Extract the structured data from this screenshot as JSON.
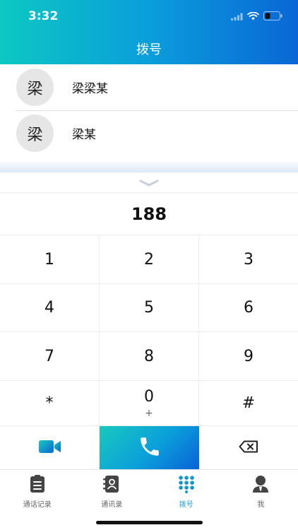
{
  "status_bar": {
    "time": "3:32"
  },
  "header": {
    "title": "拨号"
  },
  "contacts": [
    {
      "avatar": "梁",
      "name": "梁梁某"
    },
    {
      "avatar": "梁",
      "name": "梁某"
    }
  ],
  "dialer": {
    "number": "188",
    "keys": [
      {
        "main": "1",
        "sub": ""
      },
      {
        "main": "2",
        "sub": ""
      },
      {
        "main": "3",
        "sub": ""
      },
      {
        "main": "4",
        "sub": ""
      },
      {
        "main": "5",
        "sub": ""
      },
      {
        "main": "6",
        "sub": ""
      },
      {
        "main": "7",
        "sub": ""
      },
      {
        "main": "8",
        "sub": ""
      },
      {
        "main": "9",
        "sub": ""
      },
      {
        "main": "*",
        "sub": ""
      },
      {
        "main": "0",
        "sub": "+"
      },
      {
        "main": "#",
        "sub": ""
      }
    ]
  },
  "tabbar": {
    "tabs": [
      {
        "label": "通话记录",
        "icon": "clipboard-icon",
        "active": false
      },
      {
        "label": "通讯录",
        "icon": "address-book-icon",
        "active": false
      },
      {
        "label": "拨号",
        "icon": "dialpad-icon",
        "active": true
      },
      {
        "label": "我",
        "icon": "person-icon",
        "active": false
      }
    ]
  },
  "colors": {
    "accent": "#1a9bd6",
    "gradient_start": "#0cc8c2",
    "gradient_end": "#0a66d6"
  }
}
